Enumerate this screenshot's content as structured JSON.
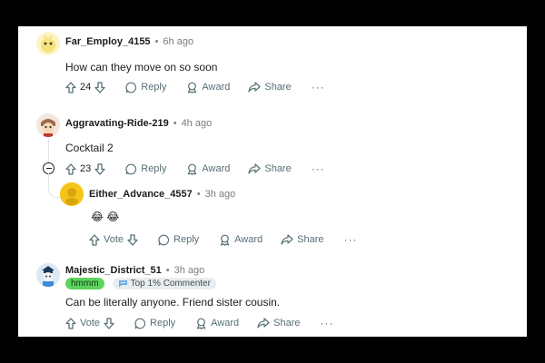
{
  "comments": [
    {
      "author": "Far_Employ_4155",
      "time": "6h ago",
      "body": "How can they move on so soon",
      "votes": "24",
      "avatar_color": "#f6e27a"
    },
    {
      "author": "Aggravating-Ride-219",
      "time": "4h ago",
      "body": "Cocktail 2",
      "votes": "23",
      "avatar_color": "#9b6b4b"
    },
    {
      "author": "Either_Advance_4557",
      "time": "3h ago",
      "body_emoji": "😂 😂",
      "votes": "Vote",
      "avatar_color": "#f5c518"
    },
    {
      "author": "Majestic_District_51",
      "time": "3h ago",
      "flair": "hmmm",
      "badge": "Top 1% Commenter",
      "body": "Can be literally anyone. Friend sister cousin.",
      "votes": "Vote",
      "avatar_color": "#3a8ed6"
    }
  ],
  "actions": {
    "reply": "Reply",
    "award": "Award",
    "share": "Share",
    "more": "···"
  },
  "separator": "•",
  "colors": {
    "page_bg": "#000000",
    "card_bg": "#ffffff",
    "action_text": "#576f76",
    "flair_green": "#5fd35f"
  }
}
